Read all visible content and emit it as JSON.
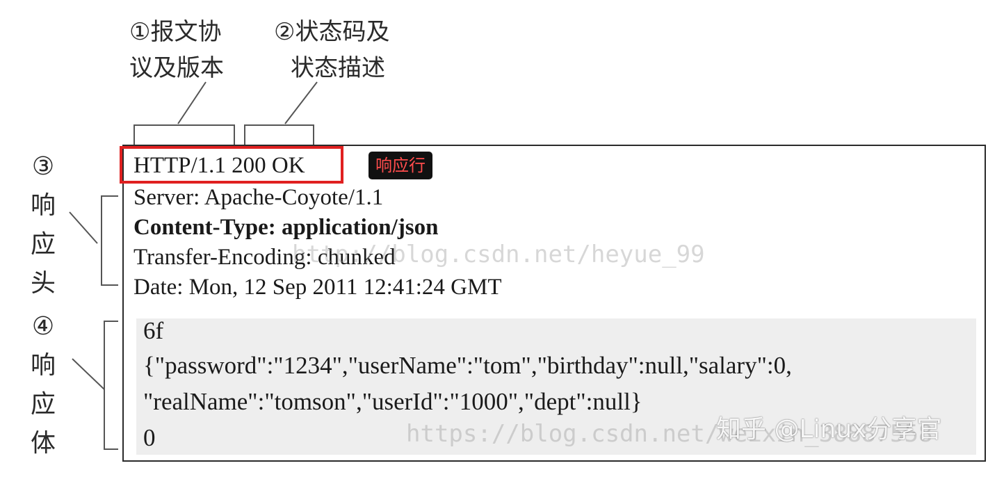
{
  "callouts": {
    "protocol": {
      "line1": "①报文协",
      "line2": "议及版本"
    },
    "status": {
      "line1": "②状态码及",
      "line2": "状态描述"
    }
  },
  "side_labels": {
    "header": [
      "③",
      "响",
      "应",
      "头"
    ],
    "body": [
      "④",
      "响",
      "应",
      "体"
    ]
  },
  "status_line": {
    "text": "HTTP/1.1 200 OK",
    "tag": "响应行",
    "tag_color": "#ff4c4c",
    "highlight_color": "#e02020"
  },
  "headers": [
    "Server: Apache-Coyote/1.1",
    "Content-Type: application/json",
    "Transfer-Encoding: chunked",
    "Date: Mon, 12 Sep 2011 12:41:24 GMT"
  ],
  "body": [
    "6f",
    "{\"password\":\"1234\",\"userName\":\"tom\",\"birthday\":null,\"salary\":0,",
    "\"realName\":\"tomson\",\"userId\":\"1000\",\"dept\":null}",
    "0"
  ],
  "watermarks": {
    "upper": "http://blog.csdn.net/heyue_99",
    "lower": "https://blog.csdn.net/weixin_38887558",
    "logo": "知乎 @Linux分享官"
  }
}
